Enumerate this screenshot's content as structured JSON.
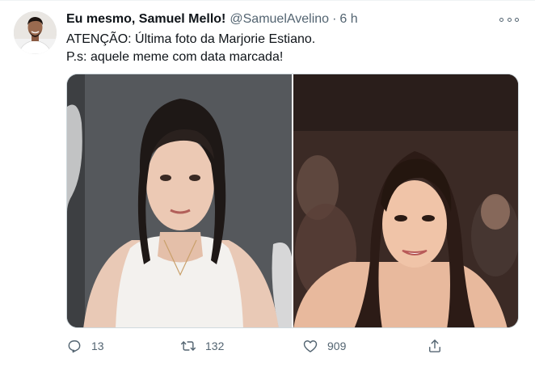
{
  "tweet": {
    "display_name": "Eu mesmo, Samuel Mello!",
    "handle": "@SamuelAvelino",
    "separator": "·",
    "time": "6 h",
    "text_line1": "ATENÇÃO: Última foto da Marjorie Estiano.",
    "text_line2": "P.s: aquele meme com data marcada!"
  },
  "actions": {
    "replies": "13",
    "retweets": "132",
    "likes": "909"
  },
  "icons": {
    "avatar": "avatar-photo",
    "more": "more-dots-icon",
    "reply": "reply-icon",
    "retweet": "retweet-icon",
    "like": "heart-icon",
    "share": "share-icon"
  },
  "colors": {
    "text": "#0f1419",
    "secondary": "#536471",
    "border": "#cfd9de"
  }
}
